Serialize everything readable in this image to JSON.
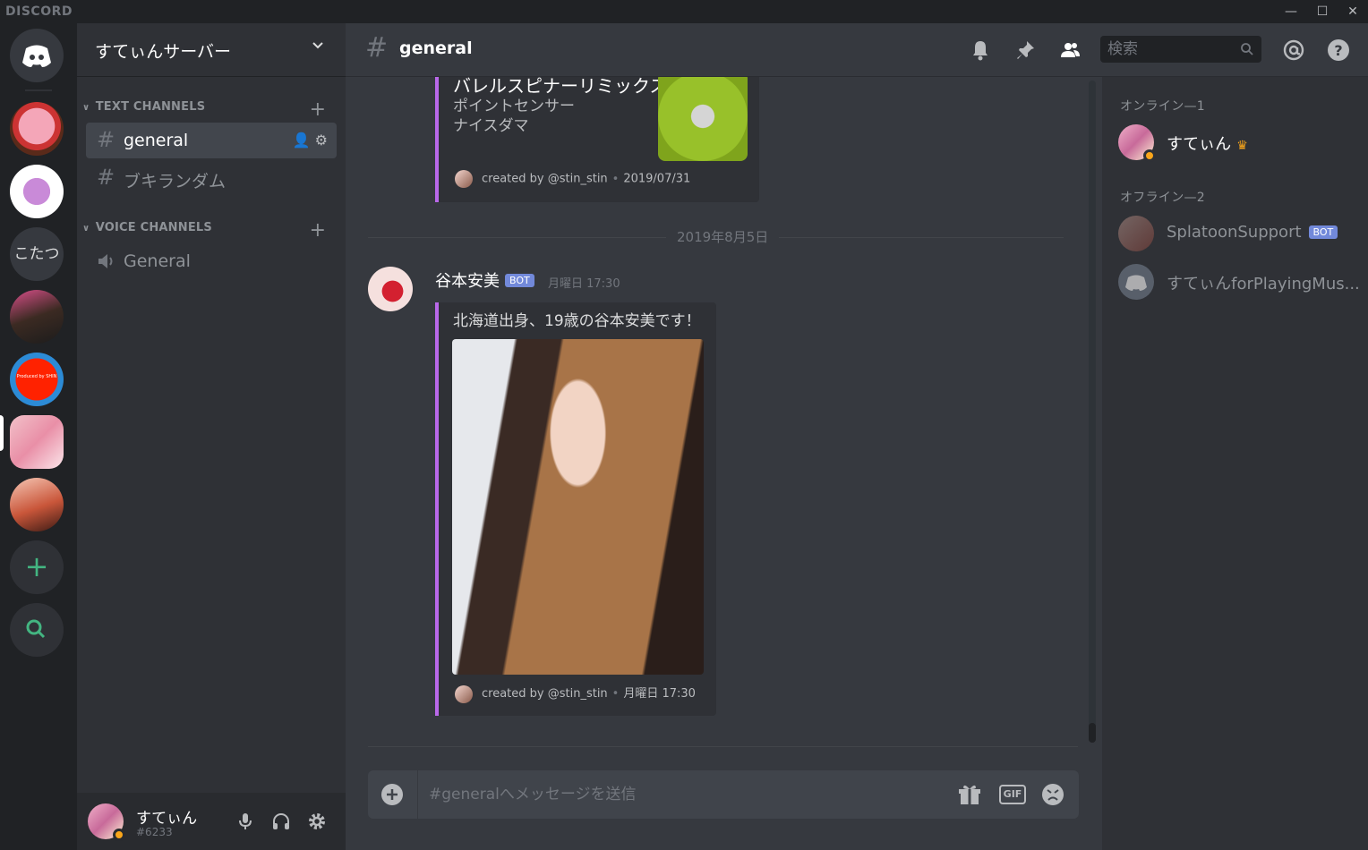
{
  "app": {
    "brand": "DISCORD"
  },
  "guilds": [
    {
      "name": "kirby-server"
    },
    {
      "name": "duck-server"
    },
    {
      "name": "kotatsu",
      "label": "こたつ"
    },
    {
      "name": "party-server"
    },
    {
      "name": "red-circle-server",
      "label": "Produced by SHIN"
    },
    {
      "name": "selfie-server"
    },
    {
      "name": "friends-server"
    }
  ],
  "server": {
    "name": "すてぃんサーバー",
    "text_category": "TEXT CHANNELS",
    "voice_category": "VOICE CHANNELS",
    "text_channels": [
      {
        "name": "general",
        "active": true
      },
      {
        "name": "ブキランダム",
        "active": false
      }
    ],
    "voice_channels": [
      {
        "name": "General"
      }
    ]
  },
  "user": {
    "name": "すてぃん",
    "tag": "#6233"
  },
  "chat": {
    "channel": "general",
    "search_placeholder": "検索",
    "composer_placeholder": "#generalへメッセージを送信",
    "embed1": {
      "title": "バレルスピナーリミックス",
      "desc1": "ポイントセンサー",
      "desc2": "ナイスダマ",
      "footer_by": "created by @stin_stin",
      "footer_date": "2019/07/31"
    },
    "date_divider": "2019年8月5日",
    "message": {
      "author": "谷本安美",
      "badge": "BOT",
      "time": "月曜日 17:30",
      "embed_text": "北海道出身、19歳の谷本安美です！",
      "footer_by": "created by @stin_stin",
      "footer_date": "月曜日 17:30"
    }
  },
  "members": {
    "online_header": "オンライン—1",
    "offline_header": "オフライン—2",
    "online": [
      {
        "name": "すてぃん",
        "owner": true
      }
    ],
    "offline": [
      {
        "name": "SplatoonSupport",
        "badge": "BOT"
      },
      {
        "name": "すてぃんforPlayingMus..."
      }
    ]
  },
  "colors": {
    "accent": "#7289da",
    "embed_bar": "#b968e9",
    "online": "#43b581",
    "idle": "#faa61a"
  }
}
